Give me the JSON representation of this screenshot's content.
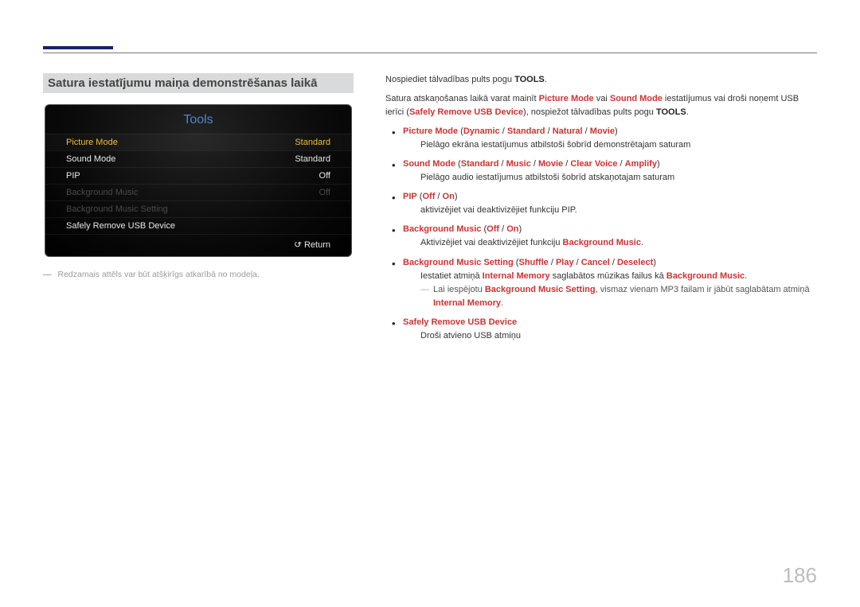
{
  "heading": "Satura iestatījumu maiņa demonstrēšanas laikā",
  "screenshot": {
    "title": "Tools",
    "rows": [
      {
        "label": "Picture Mode",
        "value": "Standard",
        "state": "selected"
      },
      {
        "label": "Sound Mode",
        "value": "Standard",
        "state": "white"
      },
      {
        "label": "PIP",
        "value": "Off",
        "state": "white"
      },
      {
        "label": "Background Music",
        "value": "Off",
        "state": "disabled"
      },
      {
        "label": "Background Music Setting",
        "value": "",
        "state": "disabled"
      },
      {
        "label": "Safely Remove USB Device",
        "value": "",
        "state": "white"
      }
    ],
    "return": "Return"
  },
  "caption": "Redzamais attēls var būt atšķirīgs atkarībā no modeļa.",
  "intro_pre": "Nospiediet tālvadības pults pogu ",
  "intro_bold": "TOOLS",
  "para2_a": "Satura atskaņošanas laikā varat mainīt ",
  "para2_pm": "Picture Mode",
  "para2_b": " vai ",
  "para2_sm": "Sound Mode",
  "para2_c": " iestatījumus vai droši noņemt USB ierīci (",
  "para2_sr": "Safely Remove USB Device",
  "para2_d": "), nospiežot tālvadības pults pogu ",
  "para2_tools": "TOOLS",
  "li1_title": "Picture Mode",
  "li1_o1": "Dynamic",
  "li1_o2": "Standard",
  "li1_o3": "Natural",
  "li1_o4": "Movie",
  "li1_desc": "Pielāgo ekrāna iestatījumus atbilstoši šobrīd demonstrētajam saturam",
  "li2_title": "Sound Mode",
  "li2_o1": "Standard",
  "li2_o2": "Music",
  "li2_o3": "Movie",
  "li2_o4": "Clear Voice",
  "li2_o5": "Amplify",
  "li2_desc": "Pielāgo audio iestatījumus atbilstoši šobrīd atskaņotajam saturam",
  "li3_title": "PIP",
  "li3_o1": "Off",
  "li3_o2": "On",
  "li3_desc": "aktivizējiet vai deaktivizējiet funkciju PIP.",
  "li4_title": "Background Music",
  "li4_o1": "Off",
  "li4_o2": "On",
  "li4_desc_a": "Aktivizējiet vai deaktivizējiet funkciju ",
  "li4_desc_b": "Background Music",
  "li5_title": "Background Music Setting",
  "li5_o1": "Shuffle",
  "li5_o2": "Play",
  "li5_o3": "Cancel",
  "li5_o4": "Deselect",
  "li5_desc_a": "Iestatiet atmiņā ",
  "li5_desc_im": "Internal Memory",
  "li5_desc_b": " saglabātos mūzikas failus kā ",
  "li5_desc_bm": "Background Music",
  "note_a": "Lai iespējotu ",
  "note_bms": "Background Music Setting",
  "note_b": ", vismaz vienam MP3 failam ir jābūt saglabātam atmiņā ",
  "note_im": "Internal Memory",
  "li6_title": "Safely Remove USB Device",
  "li6_desc": "Droši atvieno USB atmiņu",
  "page_number": "186"
}
